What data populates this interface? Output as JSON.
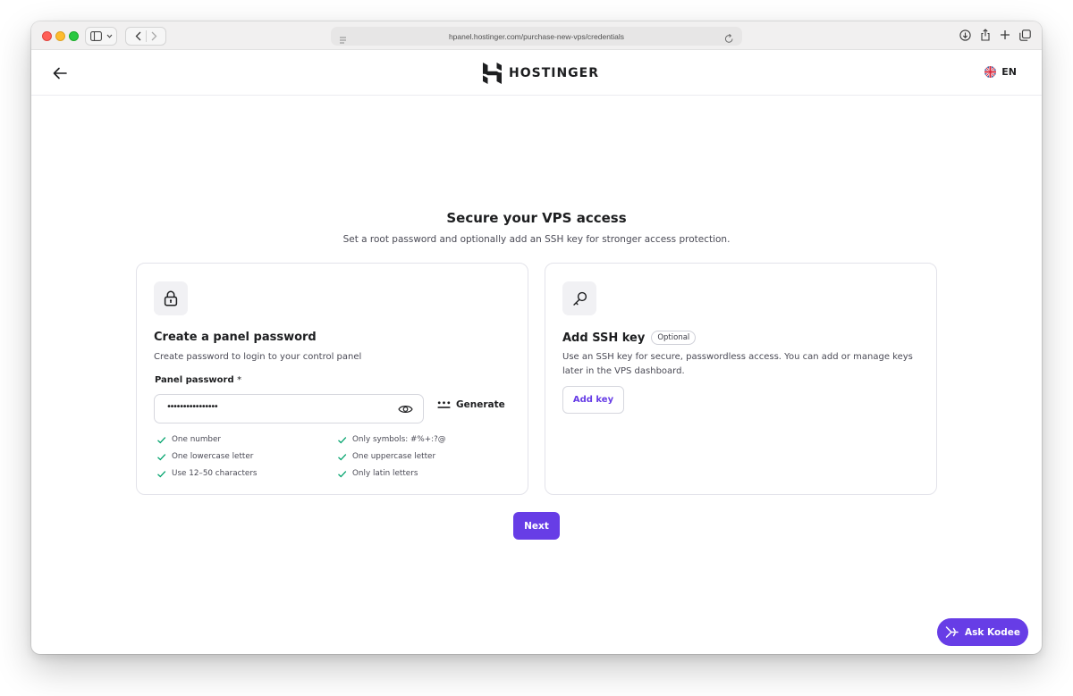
{
  "browser": {
    "url": "hpanel.hostinger.com/purchase-new-vps/credentials"
  },
  "header": {
    "brand": "HOSTINGER",
    "language": "EN"
  },
  "page": {
    "title": "Secure your VPS access",
    "subtitle": "Set a root password and optionally add an SSH key for stronger access protection."
  },
  "password_card": {
    "title": "Create a panel password",
    "description": "Create password to login to your control panel",
    "field_label": "Panel password",
    "required_mark": "*",
    "value": "••••••••••••••••",
    "generate_label": "Generate",
    "rules": [
      "One number",
      "Only symbols: #%+:?@",
      "One lowercase letter",
      "One uppercase letter",
      "Use 12–50 characters",
      "Only latin letters"
    ]
  },
  "ssh_card": {
    "title": "Add SSH key",
    "badge": "Optional",
    "description": "Use an SSH key for secure, passwordless access. You can add or manage keys later in the VPS dashboard.",
    "add_label": "Add key"
  },
  "actions": {
    "next_label": "Next",
    "assistant_label": "Ask Kodee"
  },
  "colors": {
    "primary": "#673de6",
    "success": "#00a36c",
    "text": "#1d1e20"
  }
}
